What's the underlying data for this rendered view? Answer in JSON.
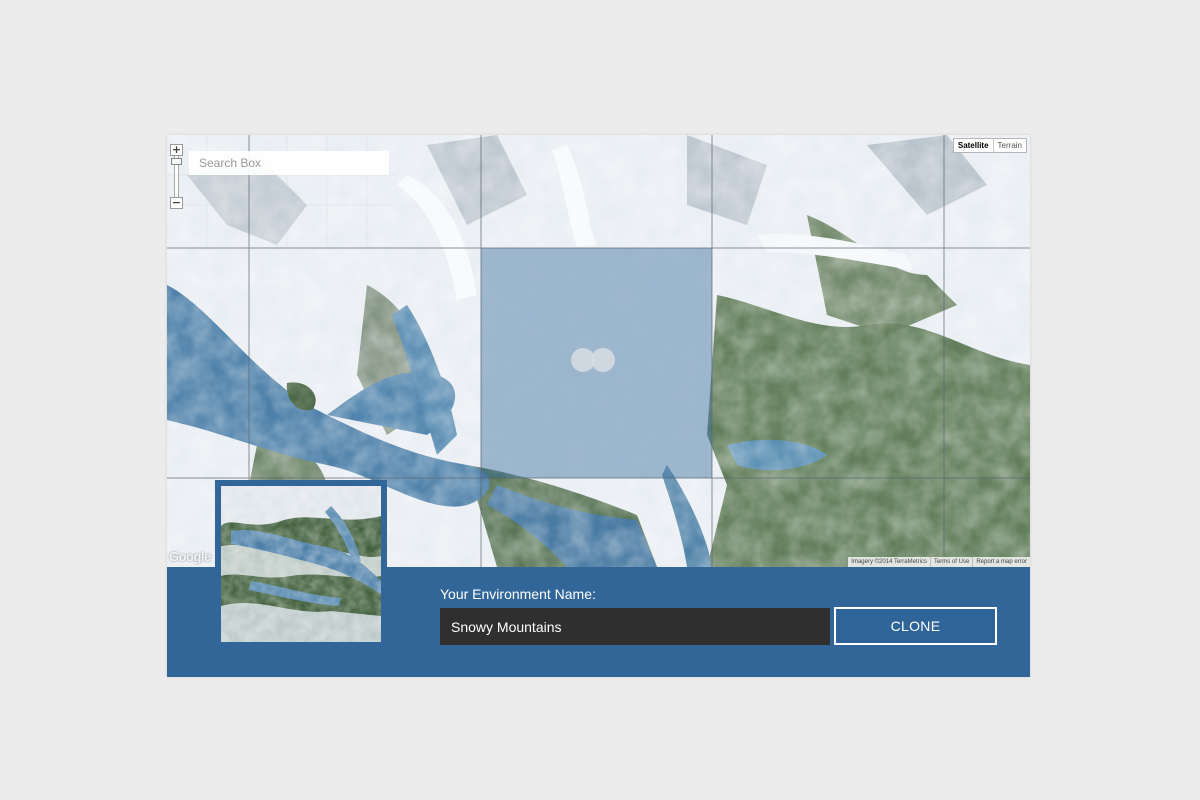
{
  "map": {
    "search_placeholder": "Search Box",
    "zoom_in": "+",
    "zoom_out": "−",
    "map_types": {
      "satellite": "Satellite",
      "terrain": "Terrain",
      "selected": "Satellite"
    },
    "attribution": {
      "imagery": "Imagery ©2014 TerraMetrics",
      "terms": "Terms of Use",
      "report": "Report a map error"
    },
    "logo": "Google"
  },
  "form": {
    "label": "Your Environment Name:",
    "name_value": "Snowy Mountains",
    "clone_label": "CLONE"
  },
  "colors": {
    "bar": "#326699",
    "input_bg": "#2f2f2f",
    "water": "#4a7fa8",
    "snow": "#eef2f6",
    "forest": "#3f5f3a"
  },
  "icons": [
    "zoom-in-icon",
    "zoom-out-icon",
    "selection-marker-icon"
  ]
}
